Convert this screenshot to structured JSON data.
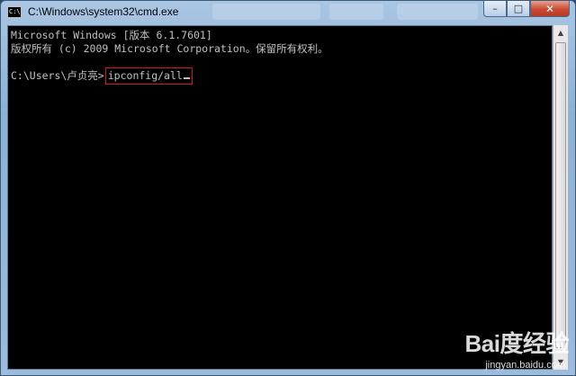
{
  "window": {
    "title": "C:\\Windows\\system32\\cmd.exe",
    "icon_text": "C:\\",
    "controls": {
      "minimize": "–",
      "maximize": "□",
      "close": "✕"
    }
  },
  "console": {
    "line1": "Microsoft Windows [版本 6.1.7601]",
    "line2": "版权所有 (c) 2009 Microsoft Corporation。保留所有权利。",
    "prompt": "C:\\Users\\卢贞亮>",
    "command": "ipconfig/all",
    "text_color": "#c0c0c0",
    "background": "#000000",
    "highlight_color": "#d4141e"
  },
  "watermark": {
    "logo": "Bai度经验",
    "url": "jingyan.baidu.com"
  }
}
